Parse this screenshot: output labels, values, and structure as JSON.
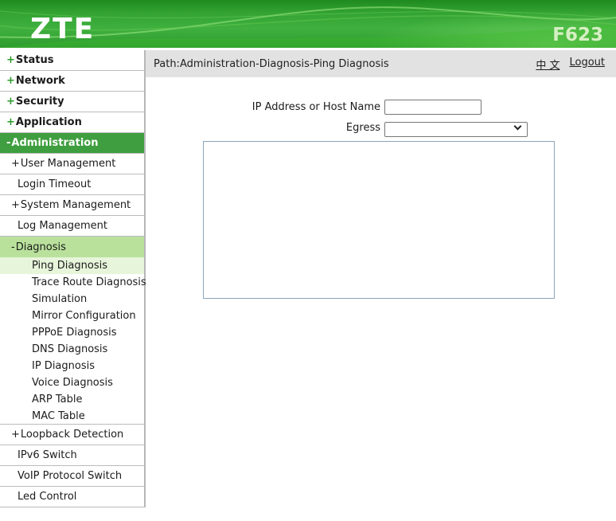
{
  "colors": {
    "brand-green": "#2e9b2e",
    "active-green": "#3f9e3f",
    "open-green": "#b9e19c",
    "selected-green": "#e7f5da"
  },
  "header": {
    "logo": "ZTE",
    "model": "F623"
  },
  "topbar": {
    "path": "Path:Administration-Diagnosis-Ping Diagnosis",
    "language_label": "中 文",
    "logout_label": "Logout"
  },
  "sidebar": {
    "items": [
      {
        "label": "Status",
        "prefix": "+",
        "level": 1
      },
      {
        "label": "Network",
        "prefix": "+",
        "level": 1
      },
      {
        "label": "Security",
        "prefix": "+",
        "level": 1
      },
      {
        "label": "Application",
        "prefix": "+",
        "level": 1
      },
      {
        "label": "Administration",
        "prefix": "-",
        "level": 1,
        "state": "active"
      },
      {
        "label": "User Management",
        "prefix": "+",
        "level": 2
      },
      {
        "label": "Login Timeout",
        "level": 2
      },
      {
        "label": "System Management",
        "prefix": "+",
        "level": 2
      },
      {
        "label": "Log Management",
        "level": 2
      },
      {
        "label": "Diagnosis",
        "prefix": "-",
        "level": 2,
        "state": "open",
        "border": false
      },
      {
        "label": "Ping Diagnosis",
        "level": 3,
        "state": "selected"
      },
      {
        "label": "Trace Route Diagnosis",
        "level": 3
      },
      {
        "label": "Simulation",
        "level": 3
      },
      {
        "label": "Mirror Configuration",
        "level": 3
      },
      {
        "label": "PPPoE Diagnosis",
        "level": 3
      },
      {
        "label": "DNS Diagnosis",
        "level": 3
      },
      {
        "label": "IP Diagnosis",
        "level": 3
      },
      {
        "label": "Voice Diagnosis",
        "level": 3
      },
      {
        "label": "ARP Table",
        "level": 3
      },
      {
        "label": "MAC Table",
        "level": 3,
        "border": true
      },
      {
        "label": "Loopback Detection",
        "prefix": "+",
        "level": 2
      },
      {
        "label": "IPv6 Switch",
        "level": 2
      },
      {
        "label": "VoIP Protocol Switch",
        "level": 2
      },
      {
        "label": "Led Control",
        "level": 2
      }
    ]
  },
  "form": {
    "ip_label": "IP Address or Host Name",
    "ip_value": "",
    "egress_label": "Egress",
    "egress_value": "",
    "result_text": ""
  }
}
